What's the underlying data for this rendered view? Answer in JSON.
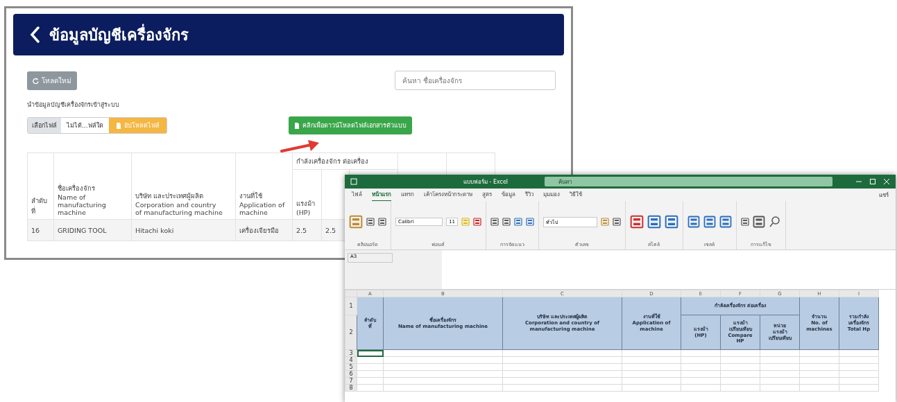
{
  "app": {
    "title": "ข้อมูลบัญชีเครื่องจักร",
    "reload_button": "โหลดใหม่",
    "search": {
      "placeholder": "ค้นหา ชื่อเครื่องจักร"
    },
    "import_label": "นำข้อมูลบัญชีเครื่องจักรเข้าสู่ระบบ",
    "file_input": {
      "button": "เลือกไฟล์",
      "status": "ไม่ได้...ฟล์ใด"
    },
    "upload_button": "อัปโหลดไฟล์",
    "download_button": "คลิกเพื่อดาวน์โหลดไฟล์เอกสารตัวแบบ",
    "table": {
      "group_header": "กำลังเครื่องจักร ต่อเครื่อง",
      "columns": [
        {
          "lines": [
            "ลำดับ",
            "ที่"
          ]
        },
        {
          "lines": [
            "ชื่อเครื่องจักร",
            "Name of",
            "manufacturing",
            "machine"
          ]
        },
        {
          "lines": [
            "บริษัท และประเทศผู้ผลิต",
            "Corporation and country",
            "of manufacturing machine"
          ]
        },
        {
          "lines": [
            "งานที่ใช้",
            "Application of",
            "machine"
          ]
        },
        {
          "lines": [
            "แรงม้า",
            "(HP)"
          ]
        }
      ],
      "rows": [
        {
          "cells": [
            "16",
            "GRIDING TOOL",
            "Hitachi koki",
            "เครื่องเจียรมือ",
            "2.5",
            "2.5"
          ]
        }
      ]
    }
  },
  "excel": {
    "window_title": "แบบฟอร์ม - Excel",
    "search_placeholder": "ค้นหา",
    "share_button": "แชร์",
    "tabs": [
      {
        "label": "ไฟล์",
        "selected": false
      },
      {
        "label": "หน้าแรก",
        "selected": true
      },
      {
        "label": "แทรก",
        "selected": false
      },
      {
        "label": "เค้าโครงหน้ากระดาษ",
        "selected": false
      },
      {
        "label": "สูตร",
        "selected": false
      },
      {
        "label": "ข้อมูล",
        "selected": false
      },
      {
        "label": "รีวิว",
        "selected": false
      },
      {
        "label": "มุมมอง",
        "selected": false
      },
      {
        "label": "วิธีใช้",
        "selected": false
      }
    ],
    "font_name": "Calibri",
    "font_size": "11",
    "number_format": "ทั่วไป",
    "ribbon_groups": [
      "คลิปบอร์ด",
      "ฟอนต์",
      "การจัดแนว",
      "ตัวเลข",
      "สไตล์",
      "เซลล์",
      "การแก้ไข"
    ],
    "name_box": "A3",
    "column_letters": [
      "A",
      "B",
      "C",
      "D",
      "E",
      "F",
      "G",
      "H",
      "I"
    ],
    "header_columns": [
      {
        "kind": "single",
        "lines": [
          "ลำดับ",
          "ที่"
        ]
      },
      {
        "kind": "single",
        "lines": [
          "ชื่อเครื่องจักร",
          "Name of manufacturing machine"
        ]
      },
      {
        "kind": "single",
        "lines": [
          "บริษัท และประเทศผู้ผลิต",
          "Corporation and country of",
          "manufacturing machine"
        ]
      },
      {
        "kind": "single",
        "lines": [
          "งานที่ใช้",
          "Application of",
          "machine"
        ]
      },
      {
        "kind": "group",
        "label": "กำลังเครื่องจักร ต่อเครื่อง",
        "children": [
          {
            "lines": [
              "แรงม้า",
              "(HP)"
            ]
          },
          {
            "lines": [
              "แรงม้า",
              "เปรียบเทียบ",
              "Compare",
              "HP"
            ]
          },
          {
            "lines": [
              "หน่วย",
              "แรงม้า",
              "เปรียบเทียบ"
            ]
          }
        ]
      },
      {
        "kind": "single",
        "lines": [
          "จำนวน",
          "No. of",
          "machines"
        ]
      },
      {
        "kind": "single",
        "lines": [
          "รวมกำลัง",
          "เครื่องจักร",
          "Total Hp"
        ]
      }
    ],
    "row_numbers": [
      "1",
      "2",
      "3",
      "4",
      "5",
      "6",
      "7",
      "8"
    ]
  }
}
